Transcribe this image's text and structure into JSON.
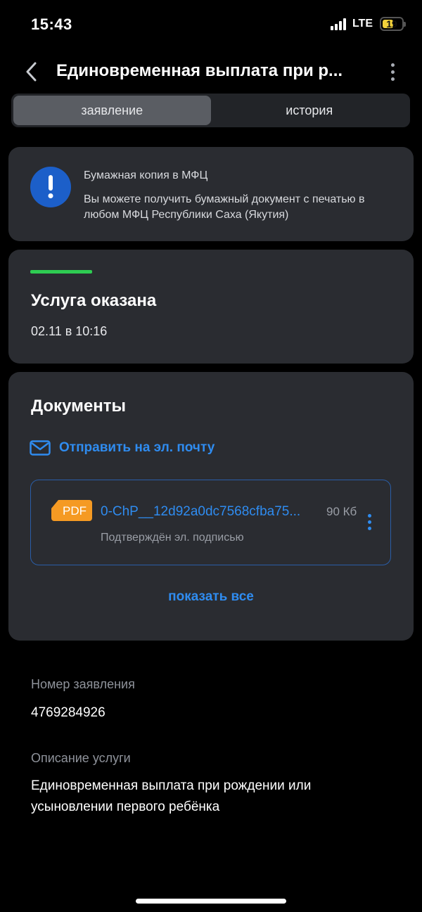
{
  "status_bar": {
    "time": "15:43",
    "network": "LTE",
    "battery": "19",
    "battery_level": 0.19
  },
  "header": {
    "title": "Единовременная выплата при р..."
  },
  "tabs": [
    {
      "label": "заявление",
      "active": true
    },
    {
      "label": "история",
      "active": false
    }
  ],
  "info_card": {
    "title": "Бумажная копия в МФЦ",
    "text": "Вы можете получить бумажный документ с печатью в любом МФЦ Республики Саха (Якутия)"
  },
  "status_card": {
    "heading": "Услуга оказана",
    "date": "02.11 в 10:16"
  },
  "documents": {
    "heading": "Документы",
    "email_link": "Отправить на эл. почту",
    "file": {
      "badge": "PDF",
      "name": "0-ChP__12d92a0dc7568cfba75...",
      "size": "90 Кб",
      "subtitle": "Подтверждён эл. подписью"
    },
    "show_all": "показать все"
  },
  "details": {
    "number_label": "Номер заявления",
    "number_value": "4769284926",
    "description_label": "Описание услуги",
    "description_value": "Единовременная выплата при рождении или усыновлении первого ребёнка"
  },
  "colors": {
    "accent": "#2f8cf0",
    "success": "#2ecc52",
    "card": "#2a2c31",
    "info_icon": "#1c5fc9",
    "pdf_badge": "#f59a23"
  }
}
